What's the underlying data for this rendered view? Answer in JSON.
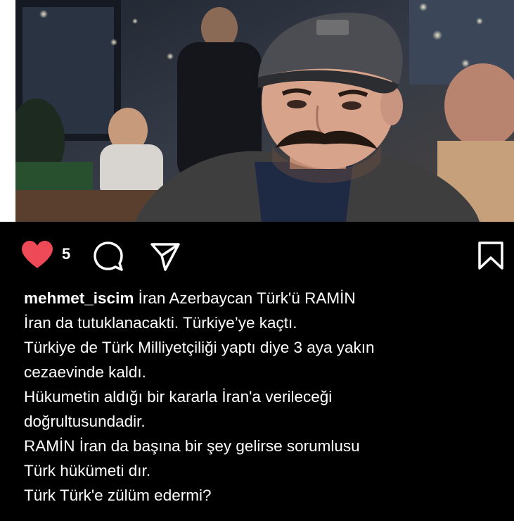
{
  "post": {
    "likes_count": "5",
    "username": "mehmet_iscim",
    "caption_lines": [
      "İran Azerbaycan Türk'ü RAMİN",
      "İran da tutuklanacakti. Türkiye’ye kaçtı.",
      "Türkiye de Türk Milliyetçiliği yaptı diye 3 aya yakın",
      "cezaevinde kaldı.",
      "Hükumetin aldığı bir kararla İran'a verileceği",
      "doğrultusundadir.",
      "RAMİN İran da başına bir şey gelirse sorumlusu",
      "Türk hükümeti dır.",
      "Türk Türk'e zülüm edermi?"
    ]
  },
  "icons": {
    "like": "heart-icon",
    "comment": "comment-bubble-icon",
    "share": "paper-plane-icon",
    "save": "bookmark-icon"
  },
  "colors": {
    "like_red": "#ed4956",
    "background": "#000000",
    "text": "#ffffff"
  }
}
